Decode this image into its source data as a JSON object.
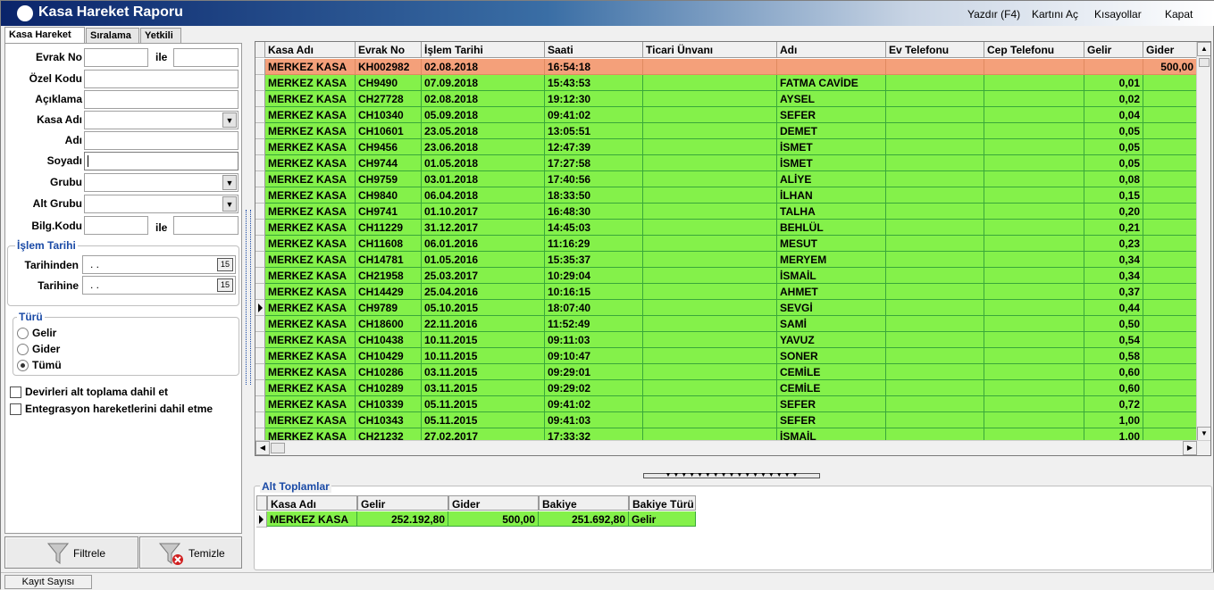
{
  "window": {
    "title": "Kasa Hareket Raporu"
  },
  "top_menu": [
    "Yazdır (F4)",
    "Kartını Aç",
    "Kısayollar",
    "Kapat"
  ],
  "tabs": [
    "Kasa Hareket",
    "Sıralama",
    "Yetkili"
  ],
  "filters": {
    "evrak_no": "Evrak No",
    "ile": "ile",
    "ozel_kodu": "Özel Kodu",
    "aciklama": "Açıklama",
    "kasa_adi": "Kasa Adı",
    "adi": "Adı",
    "soyadi": "Soyadı",
    "grubu": "Grubu",
    "alt_grubu": "Alt Grubu",
    "bilg_kodu": "Bilg.Kodu",
    "islem_tarihi_group": "İşlem Tarihi",
    "tarihinden": "Tarihinden",
    "tarihine": "Tarihine",
    "date_value": " .  .",
    "turu_group": "Türü",
    "gelir": "Gelir",
    "gider": "Gider",
    "tumu": "Tümü",
    "selected_turu": "Tümü",
    "devirleri": "Devirleri alt toplama dahil et",
    "entegrasyon": "Entegrasyon hareketlerini dahil etme"
  },
  "buttons": {
    "filtrele": "Filtrele",
    "temizle": "Temizle"
  },
  "grid": {
    "columns": [
      "Kasa Adı",
      "Evrak No",
      "İşlem Tarihi",
      "Saati",
      "Ticari Ünvanı",
      "Adı",
      "Ev Telefonu",
      "Cep Telefonu",
      "Gelir",
      "Gider"
    ],
    "rows": [
      [
        "MERKEZ KASA",
        "KH002982",
        "02.08.2018",
        "16:54:18",
        "",
        "",
        "",
        "",
        "",
        "500,00"
      ],
      [
        "MERKEZ KASA",
        "CH9490",
        "07.09.2018",
        "15:43:53",
        "",
        "FATMA CAVİDE",
        "",
        "",
        "0,01",
        ""
      ],
      [
        "MERKEZ KASA",
        "CH27728",
        "02.08.2018",
        "19:12:30",
        "",
        "AYSEL",
        "",
        "",
        "0,02",
        ""
      ],
      [
        "MERKEZ KASA",
        "CH10340",
        "05.09.2018",
        "09:41:02",
        "",
        "SEFER",
        "",
        "",
        "0,04",
        ""
      ],
      [
        "MERKEZ KASA",
        "CH10601",
        "23.05.2018",
        "13:05:51",
        "",
        "DEMET",
        "",
        "",
        "0,05",
        ""
      ],
      [
        "MERKEZ KASA",
        "CH9456",
        "23.06.2018",
        "12:47:39",
        "",
        "İSMET",
        "",
        "",
        "0,05",
        ""
      ],
      [
        "MERKEZ KASA",
        "CH9744",
        "01.05.2018",
        "17:27:58",
        "",
        "İSMET",
        "",
        "",
        "0,05",
        ""
      ],
      [
        "MERKEZ KASA",
        "CH9759",
        "03.01.2018",
        "17:40:56",
        "",
        "ALİYE",
        "",
        "",
        "0,08",
        ""
      ],
      [
        "MERKEZ KASA",
        "CH9840",
        "06.04.2018",
        "18:33:50",
        "",
        "İLHAN",
        "",
        "",
        "0,15",
        ""
      ],
      [
        "MERKEZ KASA",
        "CH9741",
        "01.10.2017",
        "16:48:30",
        "",
        "TALHA",
        "",
        "",
        "0,20",
        ""
      ],
      [
        "MERKEZ KASA",
        "CH11229",
        "31.12.2017",
        "14:45:03",
        "",
        "BEHLÜL",
        "",
        "",
        "0,21",
        ""
      ],
      [
        "MERKEZ KASA",
        "CH11608",
        "06.01.2016",
        "11:16:29",
        "",
        "MESUT",
        "",
        "",
        "0,23",
        ""
      ],
      [
        "MERKEZ KASA",
        "CH14781",
        "01.05.2016",
        "15:35:37",
        "",
        "MERYEM",
        "",
        "",
        "0,34",
        ""
      ],
      [
        "MERKEZ KASA",
        "CH21958",
        "25.03.2017",
        "10:29:04",
        "",
        "İSMAİL",
        "",
        "",
        "0,34",
        ""
      ],
      [
        "MERKEZ KASA",
        "CH14429",
        "25.04.2016",
        "10:16:15",
        "",
        "AHMET",
        "",
        "",
        "0,37",
        ""
      ],
      [
        "MERKEZ KASA",
        "CH9789",
        "05.10.2015",
        "18:07:40",
        "",
        "SEVGİ",
        "",
        "",
        "0,44",
        ""
      ],
      [
        "MERKEZ KASA",
        "CH18600",
        "22.11.2016",
        "11:52:49",
        "",
        "SAMİ",
        "",
        "",
        "0,50",
        ""
      ],
      [
        "MERKEZ KASA",
        "CH10438",
        "10.11.2015",
        "09:11:03",
        "",
        "YAVUZ",
        "",
        "",
        "0,54",
        ""
      ],
      [
        "MERKEZ KASA",
        "CH10429",
        "10.11.2015",
        "09:10:47",
        "",
        "SONER",
        "",
        "",
        "0,58",
        ""
      ],
      [
        "MERKEZ KASA",
        "CH10286",
        "03.11.2015",
        "09:29:01",
        "",
        "CEMİLE",
        "",
        "",
        "0,60",
        ""
      ],
      [
        "MERKEZ KASA",
        "CH10289",
        "03.11.2015",
        "09:29:02",
        "",
        "CEMİLE",
        "",
        "",
        "0,60",
        ""
      ],
      [
        "MERKEZ KASA",
        "CH10339",
        "05.11.2015",
        "09:41:02",
        "",
        "SEFER",
        "",
        "",
        "0,72",
        ""
      ],
      [
        "MERKEZ KASA",
        "CH10343",
        "05.11.2015",
        "09:41:03",
        "",
        "SEFER",
        "",
        "",
        "1,00",
        ""
      ],
      [
        "MERKEZ KASA",
        "CH21232",
        "27.02.2017",
        "17:33:32",
        "",
        "İSMAİL",
        "",
        "",
        "1,00",
        ""
      ]
    ],
    "row_colors": {
      "gider": "#f4a07a",
      "gelir": "#84f14a"
    },
    "current_row": 15
  },
  "alt_toplamlar": {
    "title": "Alt Toplamlar",
    "columns": [
      "Kasa Adı",
      "Gelir",
      "Gider",
      "Bakiye",
      "Bakiye Türü"
    ],
    "row": [
      "MERKEZ KASA",
      "252.192,80",
      "500,00",
      "251.692,80",
      "Gelir"
    ]
  },
  "status": {
    "kayit_sayisi": "Kayıt Sayısı"
  }
}
